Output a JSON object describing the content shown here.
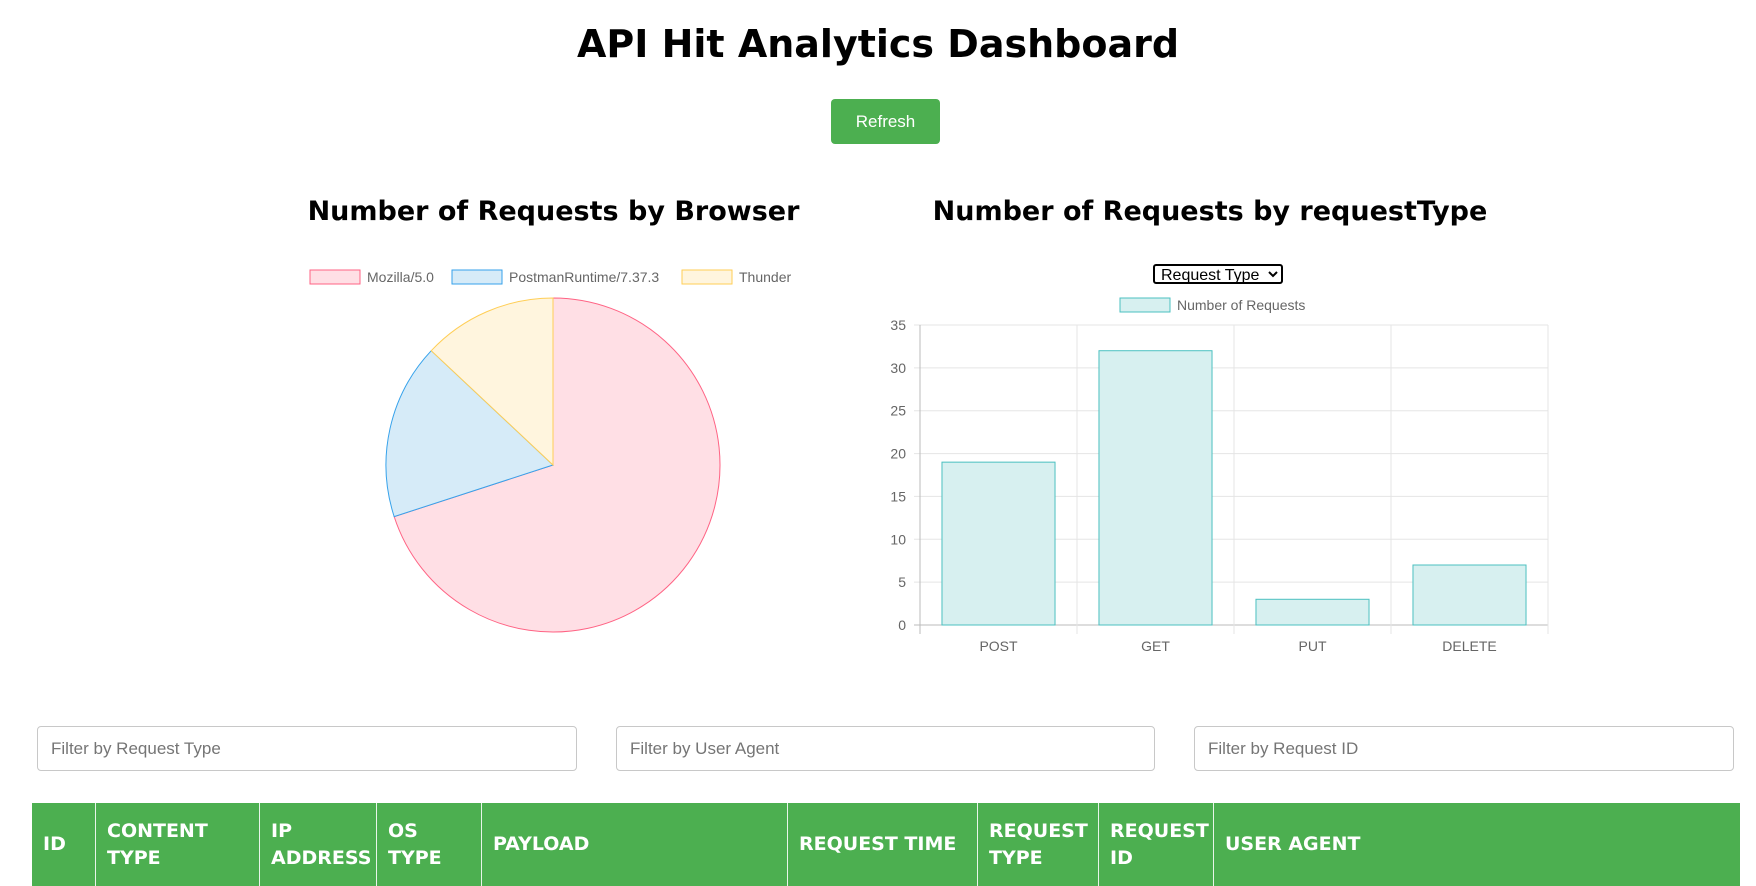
{
  "page_title": "API Hit Analytics Dashboard",
  "refresh_label": "Refresh",
  "colors": {
    "accent": "#4caf50",
    "pink_fill": "#ffdfe5",
    "pink_stroke": "#ff6384",
    "blue_fill": "#d6ebf8",
    "blue_stroke": "#36a2eb",
    "yellow_fill": "#fff5de",
    "yellow_stroke": "#ffce56",
    "teal_fill": "#d7f0f0",
    "teal_stroke": "#4bc0c0"
  },
  "pie_chart": {
    "title": "Number of Requests by Browser"
  },
  "bar_chart": {
    "title": "Number of Requests by requestType",
    "select_value": "Request Type"
  },
  "chart_data": [
    {
      "type": "pie",
      "title": "Number of Requests by Browser",
      "legend_position": "top",
      "categories": [
        "Mozilla/5.0",
        "PostmanRuntime/7.37.3",
        "Thunder"
      ],
      "values": [
        0.7,
        0.17,
        0.13
      ]
    },
    {
      "type": "bar",
      "title": "Number of Requests by requestType",
      "legend_position": "top",
      "categories": [
        "POST",
        "GET",
        "PUT",
        "DELETE"
      ],
      "series": [
        {
          "name": "Number of Requests",
          "values": [
            19,
            32,
            3,
            7
          ]
        }
      ],
      "ylim": [
        0,
        35
      ],
      "yticks": [
        0,
        5,
        10,
        15,
        20,
        25,
        30,
        35
      ],
      "grid": true
    }
  ],
  "filters": [
    {
      "placeholder": "Filter by Request Type"
    },
    {
      "placeholder": "Filter by User Agent"
    },
    {
      "placeholder": "Filter by Request ID"
    }
  ],
  "table": {
    "headers": [
      "ID",
      "CONTENT TYPE",
      "IP ADDRESS",
      "OS TYPE",
      "PAYLOAD",
      "REQUEST TIME",
      "REQUEST TYPE",
      "REQUEST ID",
      "USER AGENT"
    ]
  }
}
